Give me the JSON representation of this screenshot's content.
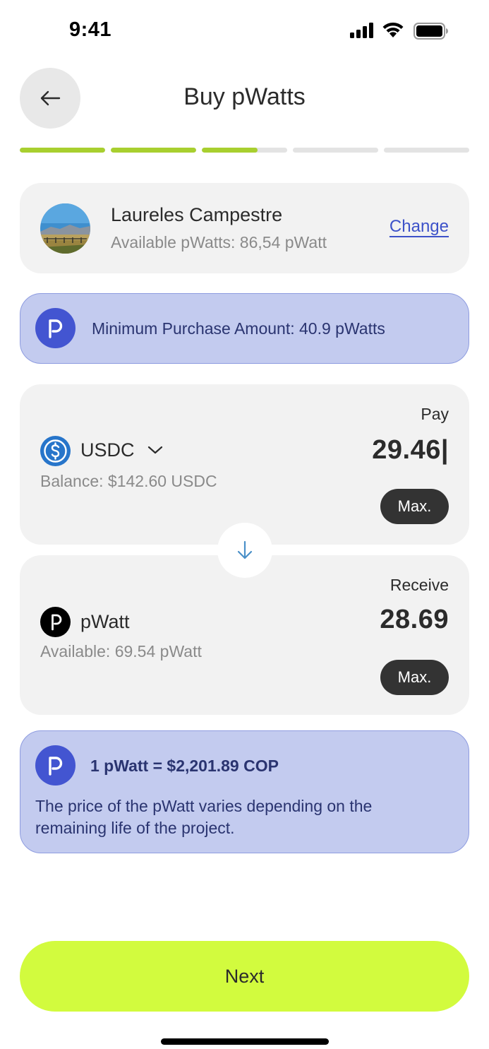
{
  "status_bar": {
    "time": "9:41"
  },
  "header": {
    "title": "Buy pWatts"
  },
  "progress": {
    "steps": [
      1,
      1,
      0.65,
      0,
      0
    ]
  },
  "project": {
    "name": "Laureles Campestre",
    "available": "Available pWatts: 86,54 pWatt",
    "change_label": "Change"
  },
  "min_banner": {
    "text": "Minimum Purchase Amount: 40.9 pWatts"
  },
  "pay": {
    "label": "Pay",
    "token": "USDC",
    "amount": "29.46|",
    "balance": "Balance: $142.60 USDC",
    "max_label": "Max."
  },
  "receive": {
    "label": "Receive",
    "token": "pWatt",
    "amount": "28.69",
    "balance": "Available: 69.54 pWatt",
    "max_label": "Max."
  },
  "rate": {
    "title": "1 pWatt = $2,201.89 COP",
    "description": "The price of the pWatt varies depending on the remaining life of the project."
  },
  "footer": {
    "next_label": "Next"
  },
  "colors": {
    "accent": "#d2fb3e",
    "progress": "#a8cf2f",
    "banner": "#c3cbef",
    "brand": "#4355d1",
    "link": "#3d52c9"
  }
}
